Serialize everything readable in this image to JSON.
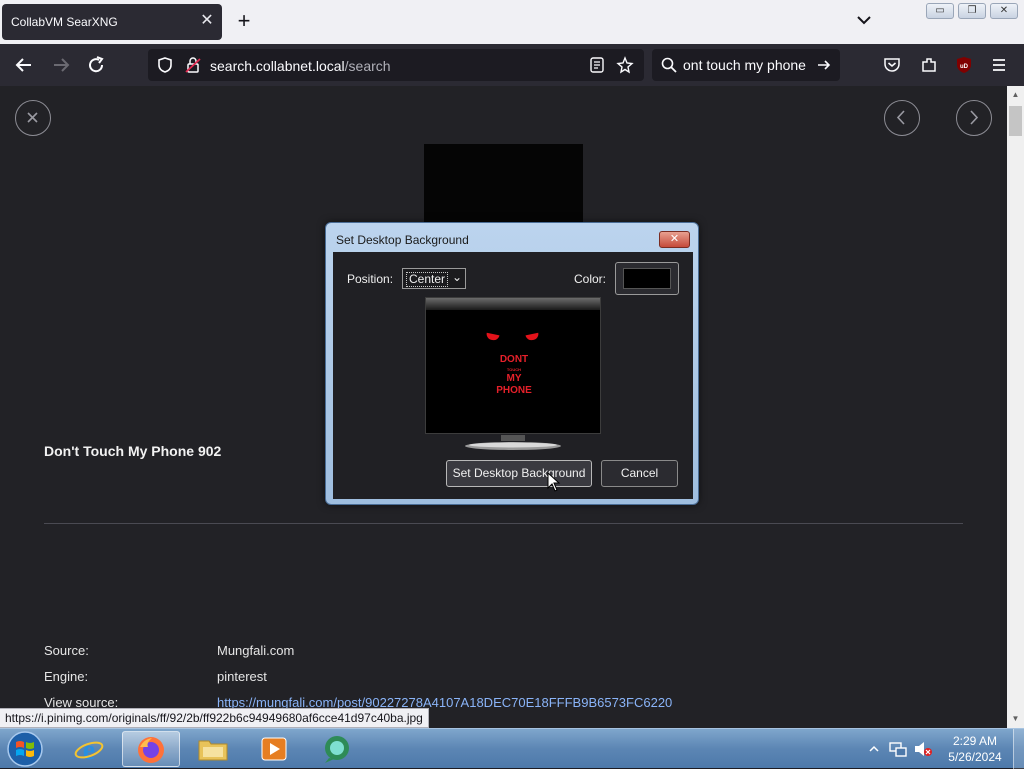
{
  "browser": {
    "tab_title": "CollabVM SearXNG",
    "tab_close": "✕",
    "new_tab": "+",
    "url_host": "search.collabnet.local",
    "url_path": "/search",
    "search_query": "ont touch my phone",
    "window_buttons": {
      "minimize": "▭",
      "restore": "❐",
      "close": "✕"
    }
  },
  "page": {
    "image_title": "Don't Touch My Phone 902",
    "meta": [
      {
        "label": "Source:",
        "value": "Mungfali.com"
      },
      {
        "label": "Engine:",
        "value": "pinterest"
      },
      {
        "label": "View source:",
        "value": "https://mungfali.com/post/90227278A4107A18DEC70E18FFFB9B6573FC6220"
      }
    ],
    "status_url": "https://i.pinimg.com/originals/ff/92/2b/ff922b6c94949680af6cce41d97c40ba.jpg"
  },
  "dialog": {
    "title": "Set Desktop Background",
    "close": "✕",
    "position_label": "Position:",
    "position_value": "Center",
    "color_label": "Color:",
    "color_value": "#000000",
    "preview_lines": [
      "DONT",
      "TOUCH",
      "MY",
      "PHONE"
    ],
    "set_button": "Set Desktop Background",
    "cancel_button": "Cancel"
  },
  "taskbar": {
    "time": "2:29 AM",
    "date": "5/26/2024",
    "pinned": [
      "internet-explorer",
      "firefox",
      "file-explorer",
      "media-player",
      "collabvm-app"
    ]
  },
  "colors": {
    "page_bg": "#222226",
    "toolbar_bg": "#2b2a33",
    "link": "#8ab4f8",
    "accent_red": "#e5202a"
  }
}
